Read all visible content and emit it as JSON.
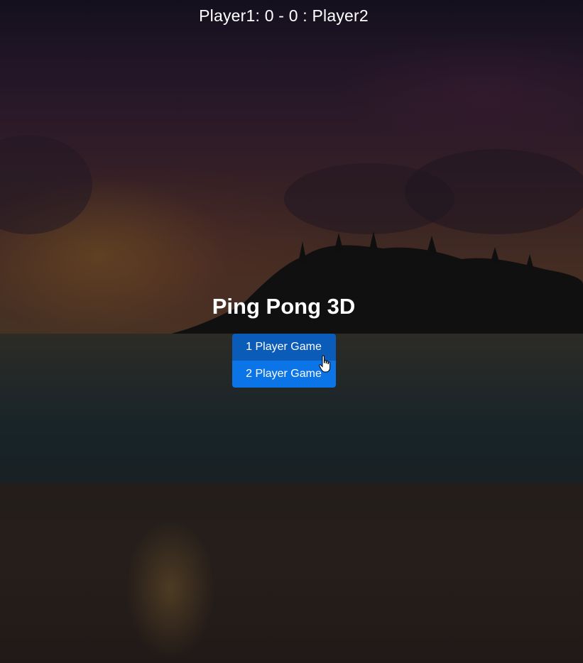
{
  "scoreboard": {
    "text": "Player1: 0 - 0 : Player2"
  },
  "menu": {
    "title": "Ping Pong 3D",
    "buttons": [
      {
        "label": "1 Player Game",
        "color": "#0b5bb8",
        "state": "hovered"
      },
      {
        "label": "2 Player Game",
        "color": "#0b74e6",
        "state": "normal"
      }
    ]
  },
  "cursor": {
    "icon": "hand-pointer-icon"
  },
  "colors": {
    "text": "#ffffff",
    "button_primary": "#0b74e6",
    "button_hover": "#0b5bb8"
  }
}
